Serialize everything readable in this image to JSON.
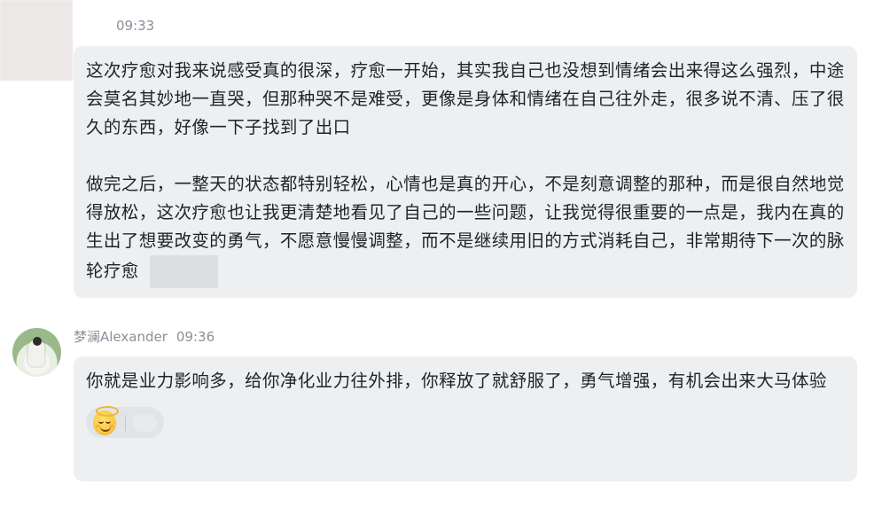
{
  "messages": [
    {
      "sender": "",
      "time": "09:33",
      "paragraphs": [
        "这次疗愈对我来说感受真的很深，疗愈一开始，其实我自己也没想到情绪会出来得这么强烈，中途会莫名其妙地一直哭，但那种哭不是难受，更像是身体和情绪在自己往外走，很多说不清、压了很久的东西，好像一下子找到了出口",
        "做完之后，一整天的状态都特别轻松，心情也是真的开心，不是刻意调整的那种，而是很自然地觉得放松，这次疗愈也让我更清楚地看见了自己的一些问题，让我觉得很重要的一点是，我内在真的生出了想要改变的勇气，不愿意慢慢调整，而不是继续用旧的方式消耗自己，非常期待下一次的脉轮疗愈"
      ]
    },
    {
      "sender": "梦澜Alexander",
      "time": "09:36",
      "text": "你就是业力影响多，给你净化业力往外排，你释放了就舒服了，勇气增强，有机会出来大马体验",
      "reaction": {
        "emoji": "smiling-face-with-halo"
      }
    }
  ]
}
